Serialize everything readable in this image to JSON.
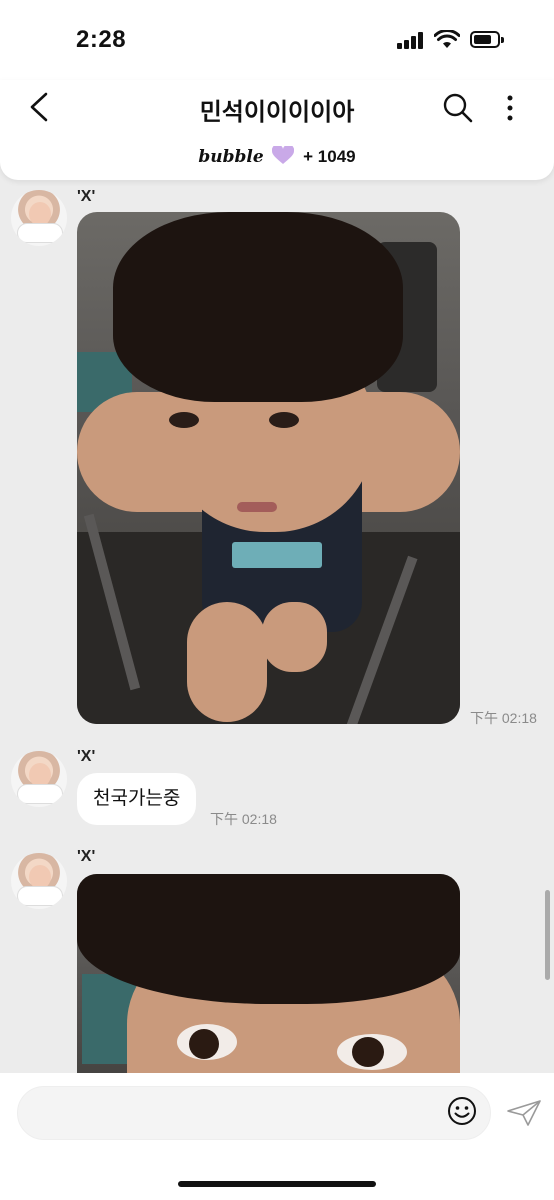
{
  "status": {
    "time": "2:28"
  },
  "header": {
    "title": "민석이이이이아",
    "brand": "bubble",
    "count": "+ 1049"
  },
  "messages": [
    {
      "sender": "'X'",
      "type": "photo",
      "time": "下午 02:18"
    },
    {
      "sender": "'X'",
      "type": "text",
      "text": "천국가는중",
      "time": "下午 02:18"
    },
    {
      "sender": "'X'",
      "type": "photo"
    }
  ],
  "input": {
    "placeholder": ""
  },
  "colors": {
    "heart": "#c9a9e8",
    "background": "#ececec",
    "timestamp": "#8a8a8a"
  }
}
